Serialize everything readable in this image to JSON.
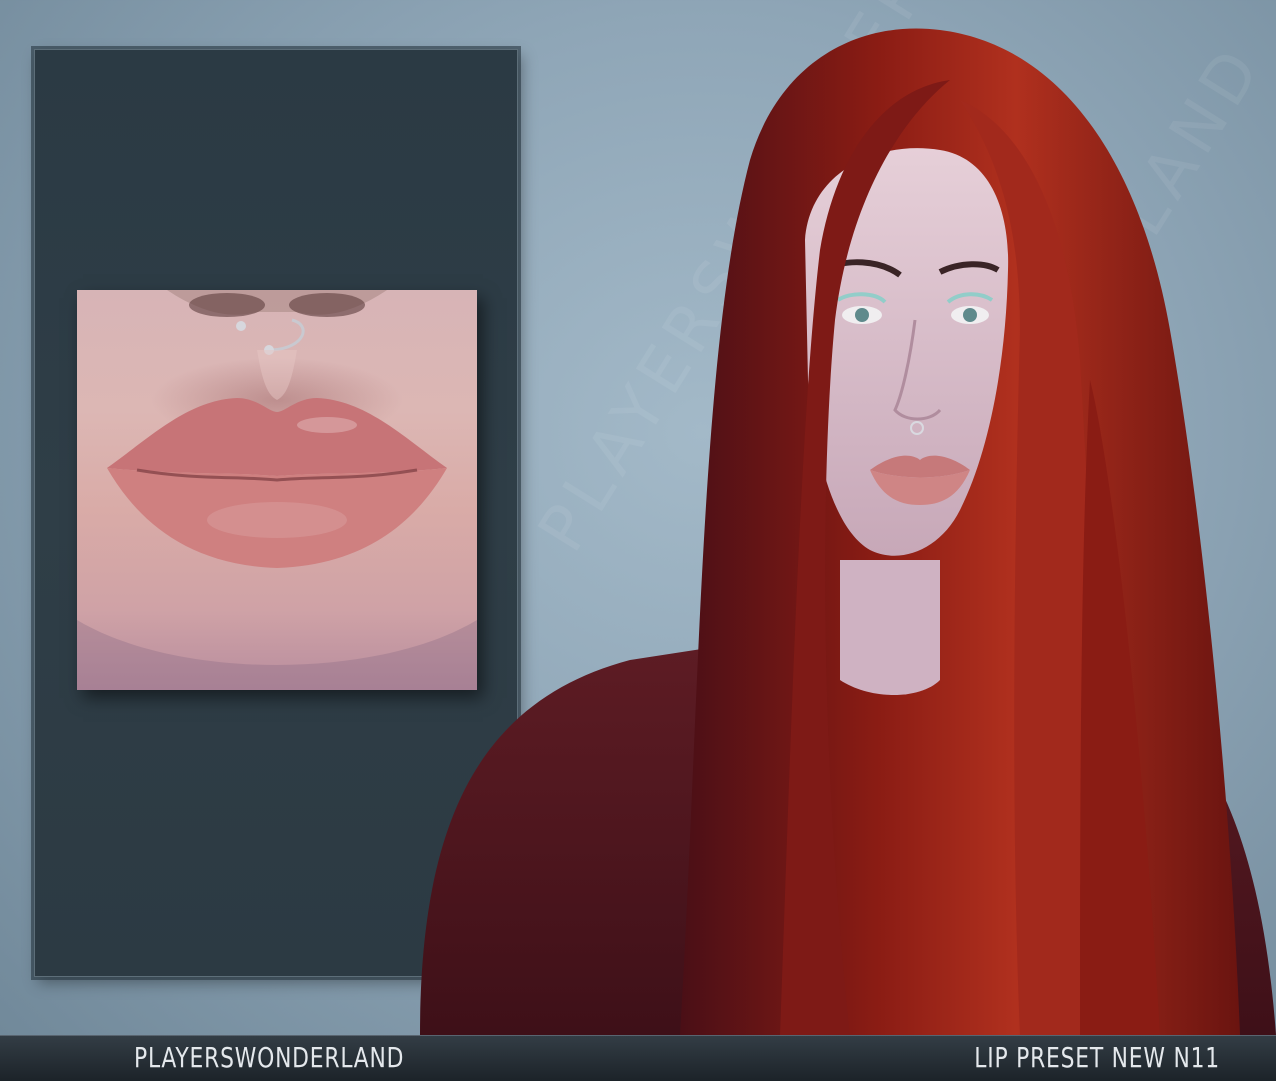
{
  "watermark": {
    "text": "PLAYERSWONDERLAND"
  },
  "footer": {
    "brand": "PLAYERSWONDERLAND",
    "product_name": "LIP PRESET NEW N11"
  },
  "colors": {
    "background": "#8fa6b7",
    "panel": "#2f3e47",
    "footer_bar": "#1c2329",
    "footer_text": "#e4e8ec",
    "hair": "#8a1c14",
    "sweater": "#5a1820",
    "lips": "#c6797a"
  },
  "images": {
    "closeup": "lips-closeup-image",
    "portrait": "model-portrait-image"
  }
}
